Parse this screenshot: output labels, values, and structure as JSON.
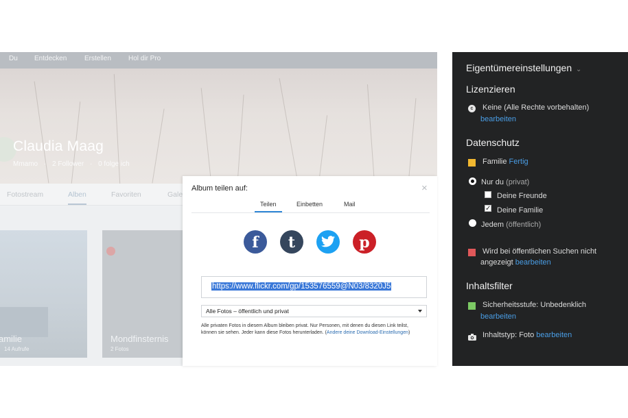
{
  "left": {
    "nav": [
      "Du",
      "Entdecken",
      "Erstellen",
      "Hol dir Pro"
    ],
    "profile": {
      "name": "Claudia Maag",
      "stats": [
        "Mmamo",
        "2 Follower",
        "0 folge ich"
      ]
    },
    "tabs": [
      "Fotostream",
      "Alben",
      "Favoriten",
      "Gale"
    ],
    "albums": [
      {
        "title": "amilie",
        "count": "14 Aufrufe"
      },
      {
        "title": "Mondfinsternis",
        "count": "2 Fotos"
      }
    ]
  },
  "dialog": {
    "title": "Album teilen auf:",
    "close": "×",
    "tabs": [
      "Teilen",
      "Einbetten",
      "Mail"
    ],
    "share_icons": [
      "facebook-icon",
      "tumblr-icon",
      "twitter-icon",
      "pinterest-icon"
    ],
    "share_glyphs": {
      "facebook": "f",
      "tumblr": "t",
      "pinterest": "p"
    },
    "url": "https://www.flickr.com/gp/153576559@N03/8320J5",
    "privacy_option": "Alle Fotos – öffentlich und privat",
    "note": "Alle privaten Fotos in diesem Album bleiben privat. Nur Personen, mit denen du diesen Link teilst, können sie sehen. Jeder kann diese Fotos herunterladen. (",
    "note_link": "Andere deine Download-Einstellungen",
    "note_end": ")"
  },
  "right": {
    "title": "Eigentümereinstellungen",
    "title_caret": "⌄",
    "license": {
      "heading": "Lizenzieren",
      "value": "Keine (Alle Rechte vorbehalten)",
      "edit": "bearbeiten",
      "icon_letter": "c"
    },
    "privacy": {
      "heading": "Datenschutz",
      "current": "Familie",
      "done": "Fertig",
      "options": [
        {
          "label": "Nur du",
          "hint": "(privat)",
          "selected": true
        },
        {
          "label": "Jedem",
          "hint": "(öffentlich)",
          "selected": false
        }
      ],
      "checks": [
        {
          "label": "Deine Freunde",
          "checked": false
        },
        {
          "label": "Deine Familie",
          "checked": true
        }
      ],
      "search_line1": "Wird bei öffentlichen Suchen nicht",
      "search_line2": "angezeigt",
      "search_edit": "bearbeiten"
    },
    "filters": {
      "heading": "Inhaltsfilter",
      "safety": "Sicherheitsstufe: Unbedenklich",
      "safety_edit": "bearbeiten",
      "type": "Inhaltstyp: Foto",
      "type_edit": "bearbeiten"
    },
    "colors": {
      "accent_link": "#4a9ee6",
      "family_icon": "#f2b830",
      "search_icon": "#e0585a",
      "safety_icon": "#7cc964"
    }
  }
}
